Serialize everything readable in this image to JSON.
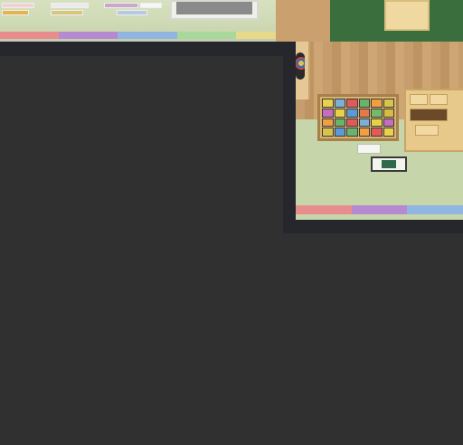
{
  "scene": {
    "name": "classroom-3d-scene",
    "stripe_colors": [
      "#e78d8d",
      "#b58ad1",
      "#8fb5e0",
      "#a8d89a",
      "#e6d98a"
    ],
    "floor_color": "#c6d6aa",
    "board_color": "#3b6e3d",
    "frame_color": "#26262d",
    "background_color": "#303030"
  },
  "icons": {
    "badge": "round-badge-icon",
    "picture_card": "picture-card-icon"
  }
}
